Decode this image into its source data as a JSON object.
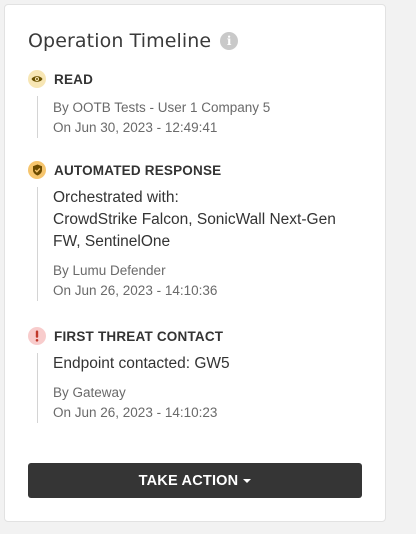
{
  "card": {
    "title": "Operation Timeline",
    "info_icon": "info-icon"
  },
  "events": [
    {
      "title": "READ",
      "icon": "eye-icon",
      "badge_bg": "#f7e6b4",
      "badge_fg": "#6b5200",
      "details": [],
      "by": "By OOTB Tests - User 1 Company 5",
      "on": "On Jun 30, 2023 - 12:49:41"
    },
    {
      "title": "AUTOMATED RESPONSE",
      "icon": "shield-check-icon",
      "badge_bg": "#f6c56d",
      "badge_fg": "#6b4a00",
      "details": [
        "Orchestrated with:",
        "CrowdStrike Falcon, SonicWall Next-Gen",
        "FW, SentinelOne"
      ],
      "by": "By Lumu Defender",
      "on": "On Jun 26, 2023 - 14:10:36"
    },
    {
      "title": "FIRST THREAT CONTACT",
      "icon": "exclamation-icon",
      "badge_bg": "#f8cccc",
      "badge_fg": "#c0392b",
      "details": [
        "Endpoint contacted: GW5"
      ],
      "by": "By Gateway",
      "on": "On Jun 26, 2023 - 14:10:23"
    }
  ],
  "action": {
    "label": "TAKE ACTION",
    "icon": "caret-down-icon"
  }
}
